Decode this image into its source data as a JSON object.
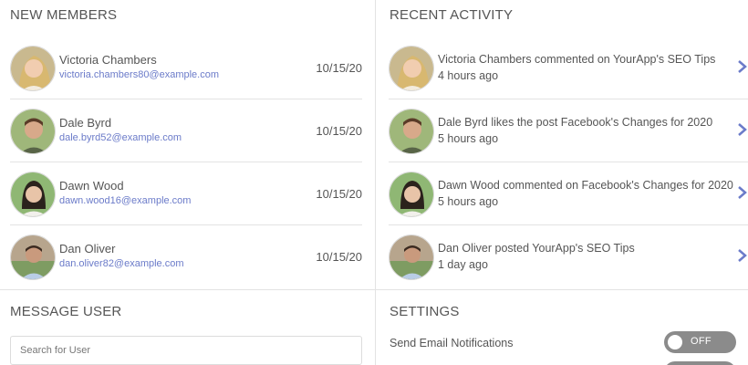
{
  "members": {
    "title": "NEW MEMBERS",
    "items": [
      {
        "name": "Victoria Chambers",
        "email": "victoria.chambers80@example.com",
        "date": "10/15/20"
      },
      {
        "name": "Dale Byrd",
        "email": "dale.byrd52@example.com",
        "date": "10/15/20"
      },
      {
        "name": "Dawn Wood",
        "email": "dawn.wood16@example.com",
        "date": "10/15/20"
      },
      {
        "name": "Dan Oliver",
        "email": "dan.oliver82@example.com",
        "date": "10/15/20"
      }
    ]
  },
  "activity": {
    "title": "RECENT ACTIVITY",
    "items": [
      {
        "text": "Victoria Chambers commented on YourApp's SEO Tips",
        "time": "4 hours ago"
      },
      {
        "text": "Dale Byrd likes the post Facebook's Changes for 2020",
        "time": "5 hours ago"
      },
      {
        "text": "Dawn Wood commented on Facebook's Changes for 2020",
        "time": "5 hours ago"
      },
      {
        "text": "Dan Oliver posted YourApp's SEO Tips",
        "time": "1 day ago"
      }
    ]
  },
  "message": {
    "title": "MESSAGE USER",
    "search_placeholder": "Search for User"
  },
  "settings": {
    "title": "SETTINGS",
    "email_notifications_label": "Send Email Notifications",
    "email_notifications_state": "OFF"
  },
  "colors": {
    "accent": "#6b7bc9",
    "toggle_off": "#8b8b8b",
    "divider": "#e3e3e3"
  }
}
